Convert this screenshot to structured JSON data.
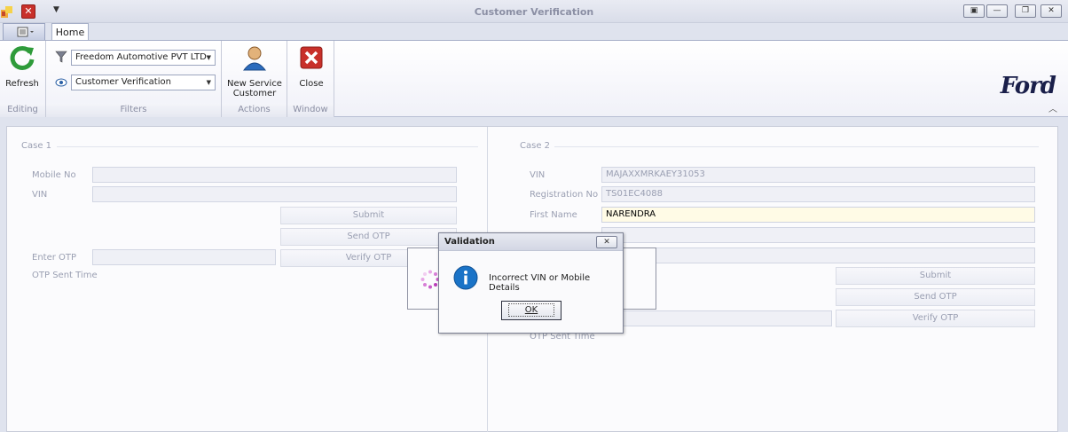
{
  "window": {
    "title": "Customer Verification",
    "controls": [
      "restore-icon",
      "minimize-icon",
      "maximize-icon",
      "close-icon"
    ]
  },
  "tabs": {
    "home": "Home"
  },
  "ribbon": {
    "refresh_label": "Refresh",
    "editing_caption": "Editing",
    "filters_caption": "Filters",
    "dealer_select": "Freedom Automotive PVT LTD",
    "view_select": "Customer Verification",
    "new_service_label_1": "New Service",
    "new_service_label_2": "Customer",
    "actions_caption": "Actions",
    "close_label": "Close",
    "window_caption": "Window",
    "brand": "Ford"
  },
  "case1": {
    "title": "Case 1",
    "mobile_label": "Mobile No",
    "mobile_value": "",
    "vin_label": "VIN",
    "vin_value": "",
    "submit_label": "Submit",
    "send_otp_label": "Send OTP",
    "enter_otp_label": "Enter OTP",
    "otp_value": "",
    "verify_otp_label": "Verify OTP",
    "otp_sent_time_label": "OTP Sent Time"
  },
  "case2": {
    "title": "Case 2",
    "vin_label": "VIN",
    "vin_value": "MAJAXXMRKAEY31053",
    "reg_label": "Registration No",
    "reg_value": "TS01EC4088",
    "first_name_label": "First Name",
    "first_name_value": "NARENDRA",
    "submit_label": "Submit",
    "send_otp_label": "Send OTP",
    "verify_otp_label": "Verify OTP",
    "otp_sent_time_label": "OTP Sent Time"
  },
  "dialog": {
    "title": "Validation",
    "message": "Incorrect VIN or Mobile Details",
    "ok_label": "OK"
  },
  "colors": {
    "accent": "#1a73c7",
    "close_red": "#c8302a",
    "refresh_green": "#2e9b3a",
    "active_field": "#fffbe6"
  }
}
